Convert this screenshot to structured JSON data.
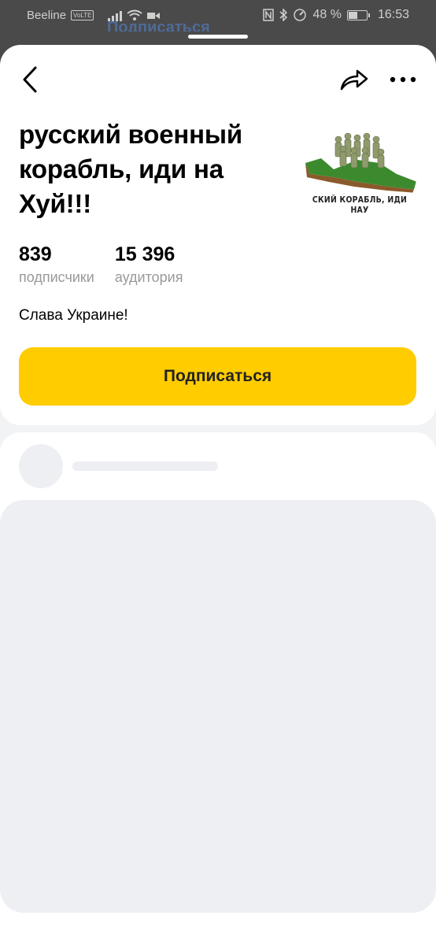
{
  "status_bar": {
    "carrier": "Beeline",
    "volte": "VoLTE",
    "battery": "48 %",
    "time": "16:53"
  },
  "background": {
    "link_text": "Подписаться"
  },
  "channel": {
    "title": "русский военный корабль, иди на Хуй!!!",
    "avatar_caption": "СКИЙ КОРАБЛЬ, ИДИ НАУ",
    "subscribers_count": "839",
    "subscribers_label": "подписчики",
    "audience_count": "15 396",
    "audience_label": "аудитория",
    "description": "Слава Украине!",
    "subscribe_label": "Подписаться"
  },
  "icons": {
    "back": "chevron-left",
    "share": "share-arrow",
    "more": "more-horizontal"
  },
  "colors": {
    "accent": "#ffcc00",
    "placeholder": "#eeeff2"
  }
}
